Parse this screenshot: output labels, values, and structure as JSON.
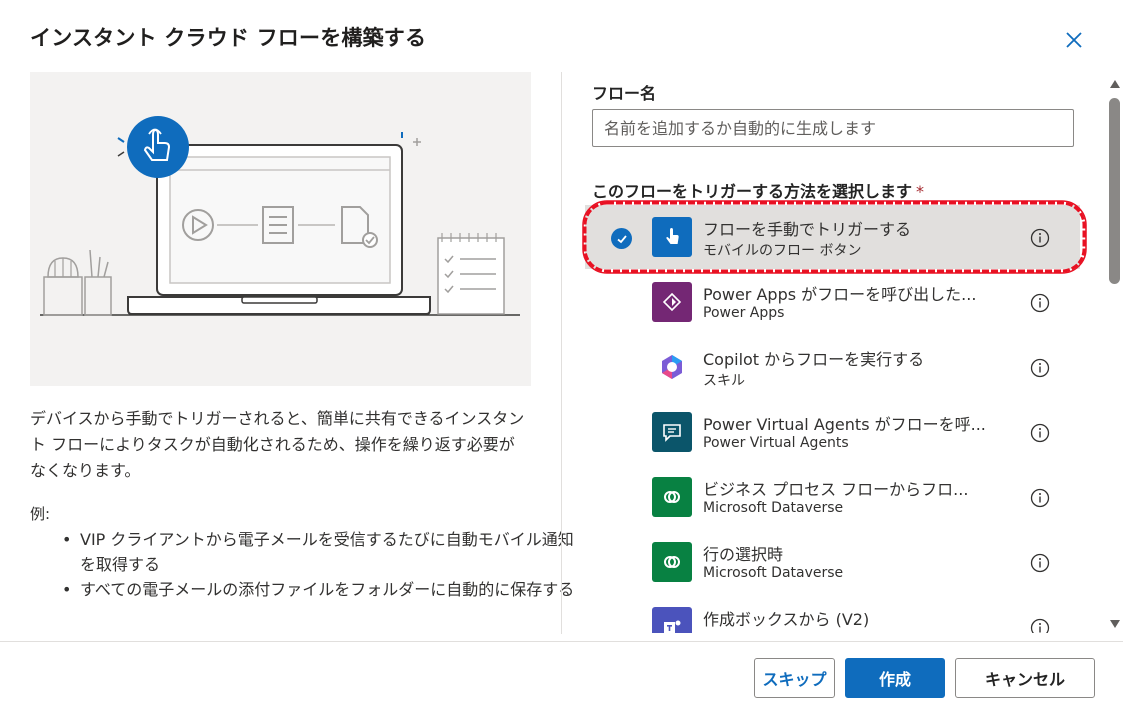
{
  "dialog": {
    "title": "インスタント クラウド フローを構築する",
    "close_icon": "close-icon"
  },
  "left": {
    "description": "デバイスから手動でトリガーされると、簡単に共有できるインスタント フローによりタスクが自動化されるため、操作を繰り返す必要がなくなります。",
    "example_label": "例:",
    "examples": [
      "VIP クライアントから電子メールを受信するたびに自動モバイル通知を取得する",
      "すべての電子メールの添付ファイルをフォルダーに自動的に保存する"
    ]
  },
  "form": {
    "flow_name_label": "フロー名",
    "flow_name_placeholder": "名前を追加するか自動的に生成します",
    "flow_name_value": "",
    "trigger_label": "このフローをトリガーする方法を選択します",
    "required_marker": "*"
  },
  "triggers": [
    {
      "title": "フローを手動でトリガーする",
      "subtitle": "モバイルのフロー ボタン",
      "icon": "hand-tap-icon",
      "color": "#0f6cbd",
      "selected": true
    },
    {
      "title": "Power Apps がフローを呼び出した...",
      "subtitle": "Power Apps",
      "icon": "power-apps-icon",
      "color": "#742774",
      "selected": false
    },
    {
      "title": "Copilot からフローを実行する",
      "subtitle": "スキル",
      "icon": "copilot-icon",
      "color": "#ffffff",
      "selected": false
    },
    {
      "title": "Power Virtual Agents がフローを呼...",
      "subtitle": "Power Virtual Agents",
      "icon": "chat-bot-icon",
      "color": "#0b556a",
      "selected": false
    },
    {
      "title": "ビジネス プロセス フローからフロ...",
      "subtitle": "Microsoft Dataverse",
      "icon": "dataverse-icon",
      "color": "#088142",
      "selected": false
    },
    {
      "title": "行の選択時",
      "subtitle": "Microsoft Dataverse",
      "icon": "dataverse-icon",
      "color": "#088142",
      "selected": false
    },
    {
      "title": "作成ボックスから (V2)",
      "subtitle": "",
      "icon": "teams-icon",
      "color": "#4b53bc",
      "selected": false
    }
  ],
  "footer": {
    "skip_label": "スキップ",
    "create_label": "作成",
    "cancel_label": "キャンセル"
  },
  "colors": {
    "accent": "#0f6cbd",
    "highlight_ring": "#e81123"
  }
}
